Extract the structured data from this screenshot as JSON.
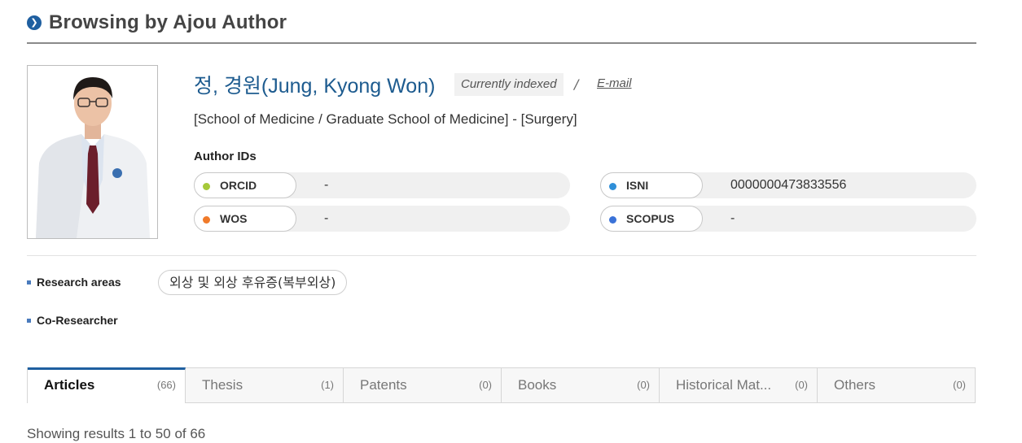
{
  "header": {
    "title": "Browsing by Ajou Author"
  },
  "author": {
    "name": "정, 경원(Jung, Kyong Won)",
    "index_status": "Currently indexed",
    "separator": "/",
    "email_label": "E-mail",
    "affiliation": "[School of Medicine / Graduate School of Medicine] - [Surgery]"
  },
  "author_ids": {
    "heading": "Author IDs",
    "items": [
      {
        "label": "ORCID",
        "value": "-",
        "color": "#a6c93a"
      },
      {
        "label": "ISNI",
        "value": "0000000473833556",
        "color": "#2f8fd8"
      },
      {
        "label": "WOS",
        "value": "-",
        "color": "#f07a2a"
      },
      {
        "label": "SCOPUS",
        "value": "-",
        "color": "#3a72d8"
      }
    ]
  },
  "research": {
    "areas_label": "Research areas",
    "areas": [
      "외상 및 외상 후유증(복부외상)"
    ],
    "co_researcher_label": "Co-Researcher"
  },
  "tabs": [
    {
      "label": "Articles",
      "count": "(66)",
      "active": true
    },
    {
      "label": "Thesis",
      "count": "(1)",
      "active": false
    },
    {
      "label": "Patents",
      "count": "(0)",
      "active": false
    },
    {
      "label": "Books",
      "count": "(0)",
      "active": false
    },
    {
      "label": "Historical Mat...",
      "count": "(0)",
      "active": false
    },
    {
      "label": "Others",
      "count": "(0)",
      "active": false
    }
  ],
  "results": {
    "summary": "Showing results 1 to 50 of 66"
  },
  "colors": {
    "accent": "#1f5fa0",
    "name": "#1d5b8f"
  }
}
